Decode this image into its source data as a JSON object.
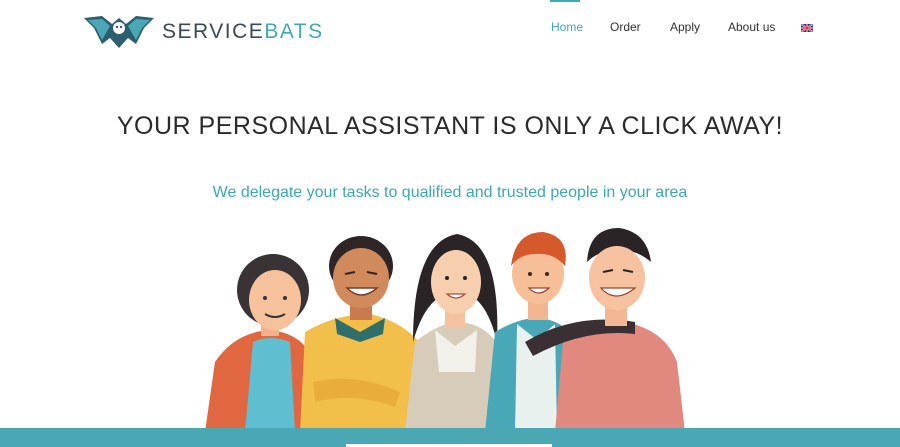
{
  "brand": {
    "name_part1": "SERVICE",
    "name_part2": "BATS",
    "logo_icon": "bat-icon"
  },
  "nav": {
    "items": [
      {
        "label": "Home",
        "active": true
      },
      {
        "label": "Order"
      },
      {
        "label": "Apply"
      },
      {
        "label": "About us"
      }
    ],
    "language_icon": "uk-flag-icon"
  },
  "hero": {
    "title": "YOUR PERSONAL ASSISTANT IS ONLY A CLICK AWAY!",
    "subtitle": "We delegate your tasks to qualified and trusted people in your area"
  },
  "colors": {
    "accent": "#3fa9b6",
    "band": "#4aa8b5",
    "text": "#2b2b2b"
  }
}
